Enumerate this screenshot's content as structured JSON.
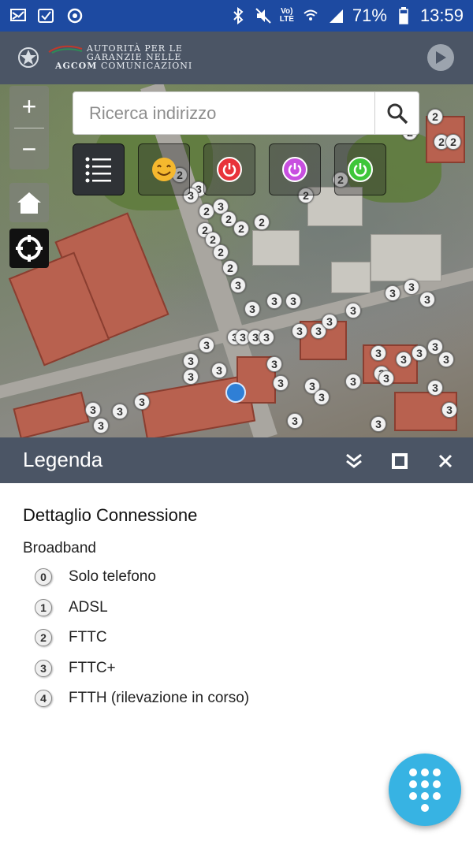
{
  "status_bar": {
    "battery": "71%",
    "time": "13:59",
    "network_label": "LTE",
    "volte_label": "Vo)",
    "icons": [
      "notification-icon",
      "map-check-icon",
      "sync-icon",
      "bluetooth-icon",
      "mute-icon",
      "volte-icon",
      "wifi-icon",
      "signal-icon",
      "battery-icon"
    ]
  },
  "header": {
    "logo_line1": "AUTORITÀ PER LE",
    "logo_line2": "GARANZIE NELLE",
    "logo_brand": "AGCOM",
    "logo_line3": "COMUNICAZIONI",
    "play_icon": "play-icon"
  },
  "map": {
    "search": {
      "placeholder": "Ricerca indirizzo",
      "value": ""
    },
    "controls": {
      "zoom_in": "+",
      "zoom_out": "−"
    },
    "filters": [
      {
        "name": "list-filter",
        "icon": "list-icon"
      },
      {
        "name": "smiley-filter",
        "icon": "smiley-icon"
      },
      {
        "name": "red-power-filter",
        "icon": "power-icon",
        "color": "#e8333a"
      },
      {
        "name": "purple-power-filter",
        "icon": "power-icon",
        "color": "#c84fe0"
      },
      {
        "name": "green-power-filter",
        "icon": "power-icon",
        "color": "#3ec63a"
      }
    ],
    "marker_labels": [
      "2",
      "3"
    ]
  },
  "legend": {
    "title": "Legenda",
    "detail_title": "Dettaglio Connessione",
    "group_title": "Broadband",
    "items": [
      {
        "badge": "0",
        "label": "Solo telefono"
      },
      {
        "badge": "1",
        "label": "ADSL"
      },
      {
        "badge": "2",
        "label": "FTTC"
      },
      {
        "badge": "3",
        "label": "FTTC+"
      },
      {
        "badge": "4",
        "label": "FTTH (rilevazione in corso)"
      }
    ]
  },
  "colors": {
    "status_bar": "#1d4aa1",
    "header": "#4b5565",
    "fab": "#37b3e3"
  }
}
